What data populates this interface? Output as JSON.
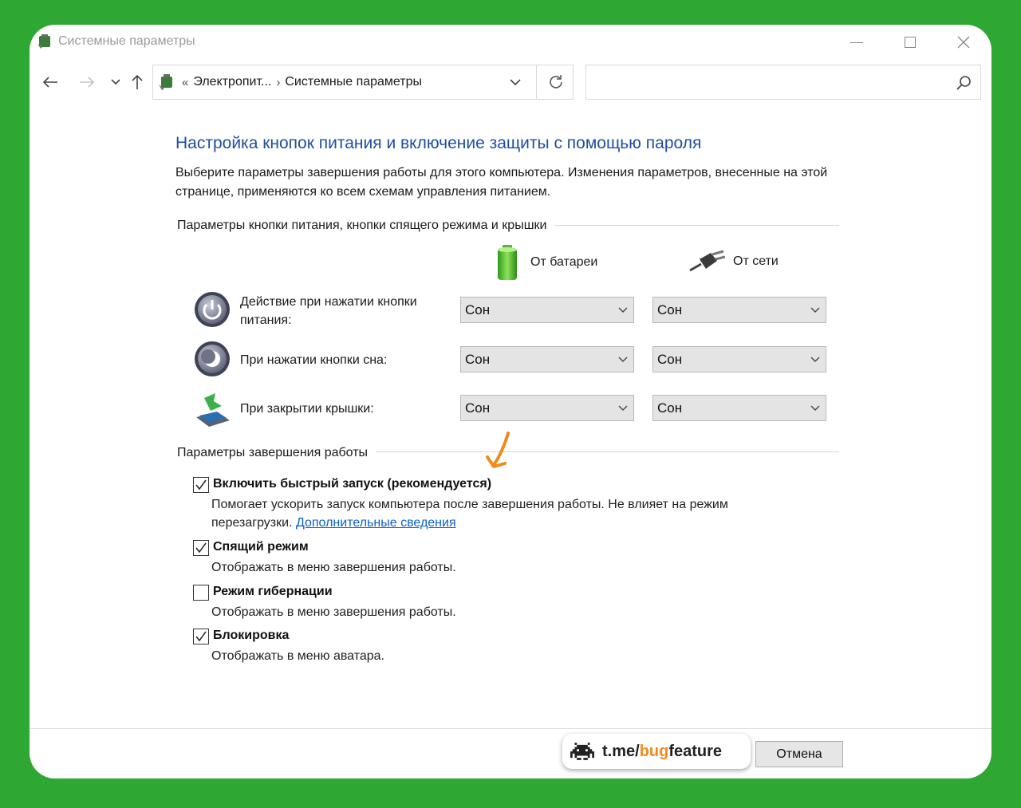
{
  "window": {
    "title": "Системные параметры"
  },
  "nav": {
    "breadcrumb_prefix": "«",
    "crumb_1": "Электропит...",
    "crumb_sep": "›",
    "crumb_2": "Системные параметры",
    "search_placeholder": ""
  },
  "page": {
    "heading": "Настройка кнопок питания и включение защиты с помощью пароля",
    "description": "Выберите параметры завершения работы для этого компьютера. Изменения параметров, внесенные на этой странице, применяются ко всем схемам управления питанием.",
    "buttons_group": "Параметры кнопки питания, кнопки спящего режима и крышки",
    "col_battery": "От батареи",
    "col_ac": "От сети",
    "rows": [
      {
        "label": "Действие при нажатии кнопки питания:",
        "battery": "Сон",
        "ac": "Сон"
      },
      {
        "label": "При нажатии кнопки сна:",
        "battery": "Сон",
        "ac": "Сон"
      },
      {
        "label": "При закрытии крышки:",
        "battery": "Сон",
        "ac": "Сон"
      }
    ],
    "shutdown_group": "Параметры завершения работы",
    "options": [
      {
        "label": "Включить быстрый запуск (рекомендуется)",
        "checked": true,
        "desc": "Помогает ускорить запуск компьютера после завершения работы. Не влияет на режим перезагрузки.",
        "link": "Дополнительные сведения"
      },
      {
        "label": "Спящий режим",
        "checked": true,
        "desc": "Отображать в меню завершения работы."
      },
      {
        "label": "Режим гибернации",
        "checked": false,
        "desc": "Отображать в меню завершения работы."
      },
      {
        "label": "Блокировка",
        "checked": true,
        "desc": "Отображать в меню аватара."
      }
    ]
  },
  "footer": {
    "badge_prefix": "t.me/",
    "badge_highlight": "bug",
    "badge_suffix": "feature",
    "cancel": "Отмена"
  },
  "colors": {
    "background": "#2ea832",
    "heading": "#1e4e9e",
    "link": "#0b5fc7",
    "arrow": "#f08a1c"
  }
}
